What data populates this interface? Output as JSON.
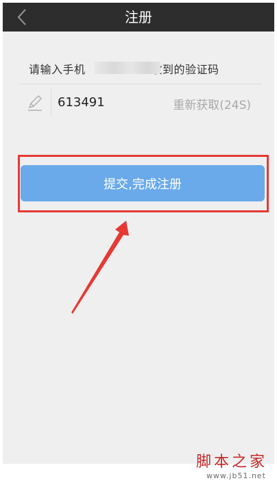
{
  "header": {
    "title": "注册"
  },
  "verify": {
    "prompt_before": "请输入手机",
    "prompt_after": "收到的验证码",
    "code_value": "613491",
    "resend_label": "重新获取(24S)"
  },
  "actions": {
    "submit_label": "提交,完成注册"
  },
  "watermark": {
    "site_chars": "脚本之家",
    "site_url": "www.jb51.net"
  },
  "colors": {
    "navbar": "#2d2d2d",
    "button": "#6aaaea",
    "annotation": "#e53935",
    "resend": "#a8a8a8"
  }
}
